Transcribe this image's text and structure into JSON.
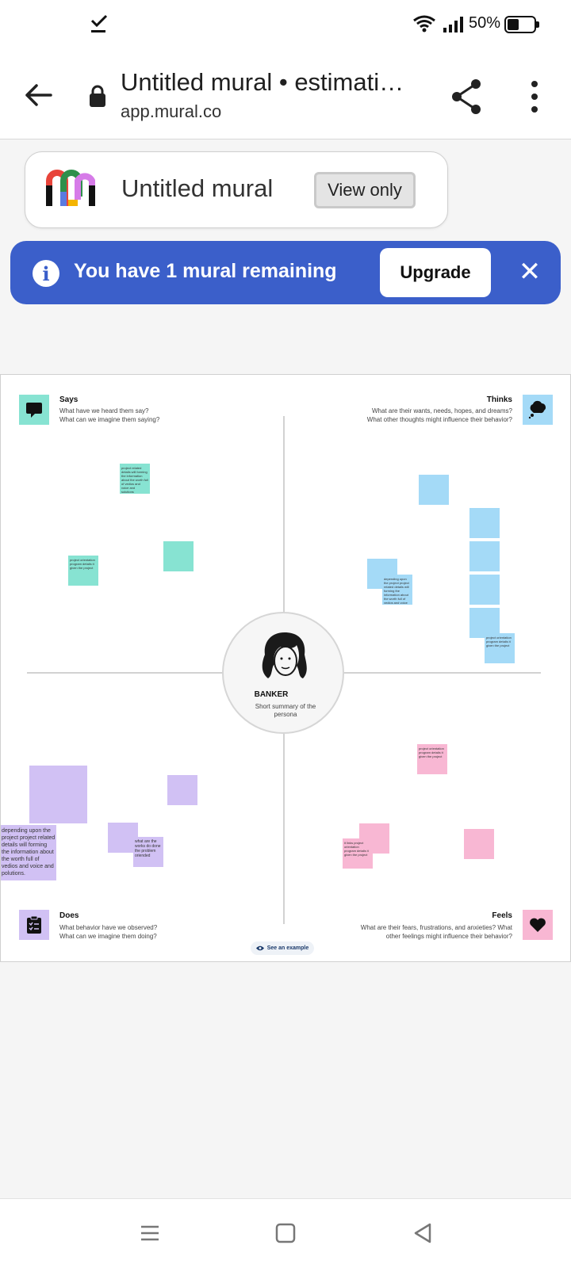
{
  "status_bar": {
    "battery_percent": "50%",
    "icons": [
      "download-check-icon",
      "wifi-icon",
      "signal-icon",
      "battery-icon"
    ]
  },
  "browser": {
    "page_title": "Untitled mural • estimati…",
    "url": "app.mural.co",
    "icons": [
      "back-arrow-icon",
      "lock-icon",
      "share-icon",
      "more-vert-icon"
    ]
  },
  "mural": {
    "title": "Untitled mural",
    "view_only_label": "View only"
  },
  "banner": {
    "message": "You have 1 mural remaining",
    "upgrade_label": "Upgrade",
    "close_label": "✕",
    "info_label": "i",
    "color": "#3b5fca"
  },
  "board": {
    "persona": {
      "name": "BANKER",
      "summary": "Short summary of the persona"
    },
    "quadrants": {
      "says": {
        "title": "Says",
        "line1": "What have we heard them say?",
        "line2": "What can we imagine them saying?",
        "color": "#87e3d2",
        "icon": "speech-bubble-icon"
      },
      "thinks": {
        "title": "Thinks",
        "line1": "What are their wants, needs, hopes, and dreams?",
        "line2": "What other thoughts might influence their behavior?",
        "color": "#a4daf7",
        "icon": "thought-cloud-icon"
      },
      "does": {
        "title": "Does",
        "line1": "What behavior have we observed?",
        "line2": "What can we imagine them doing?",
        "color": "#d1c1f4",
        "icon": "clipboard-icon"
      },
      "feels": {
        "title": "Feels",
        "line1": "What are their fears, frustrations, and anxieties? What",
        "line2": "other feelings might influence their behavior?",
        "color": "#f8b7d3",
        "icon": "heart-icon"
      }
    },
    "stickies": {
      "says_1": "project related details will forming the information about the worth full of vedios and voice and solutions",
      "says_2": "project orientation program details it given the project",
      "thinks_1": "depending upon the project project related details will forming the information about the worth full of vedios and voice and solutions",
      "thinks_2": "project orientation program details it given the project",
      "does_1": "depending upon the project project related details will forming the information about the worth full of vedios and voice and polutions.",
      "does_2": "what are the works do done the problem oriended",
      "feels_1": "project orientation program details it given the project",
      "feels_2": "it links project orientation program details it given the project"
    },
    "see_example_label": "See an example"
  },
  "nav_bar": {
    "icons": [
      "menu-icon",
      "home-square-icon",
      "back-triangle-icon"
    ]
  }
}
